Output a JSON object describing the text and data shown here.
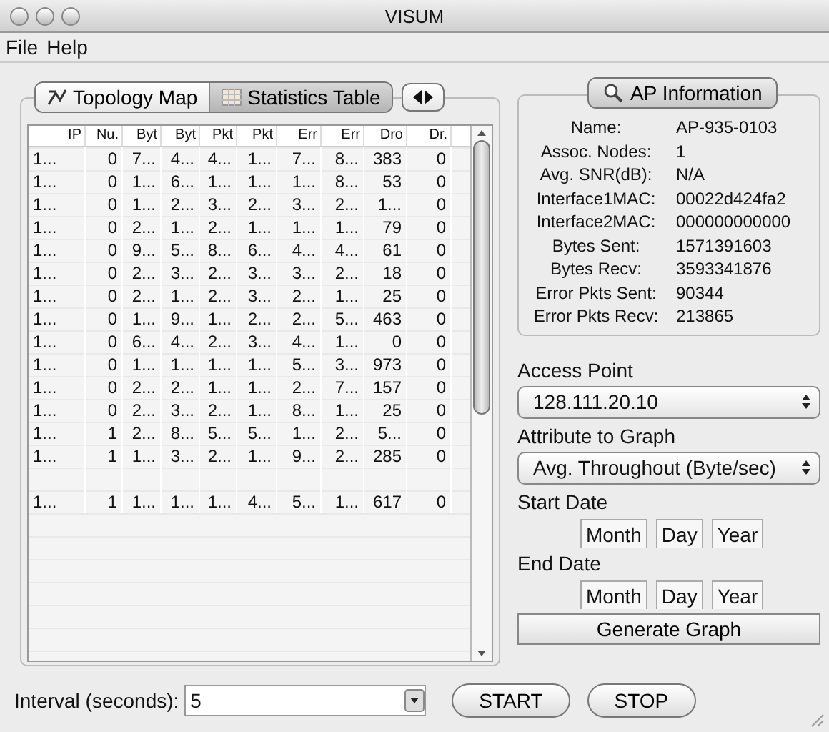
{
  "window": {
    "title": "VISUM"
  },
  "menu": [
    "File",
    "Help"
  ],
  "tabs": [
    {
      "label": "Topology Map",
      "selected": false,
      "kind": "topology"
    },
    {
      "label": "Statistics Table",
      "selected": true,
      "kind": "table"
    }
  ],
  "table": {
    "columns": [
      "IP",
      "Nu.",
      "Byt",
      "Byt",
      "Pkt",
      "Pkt",
      "Err",
      "Err",
      "Dro",
      "Dr."
    ],
    "rows": [
      {
        "kind": "data",
        "cells": [
          "1...",
          "0",
          "7...",
          "4...",
          "4...",
          "1...",
          "7...",
          "8...",
          "383",
          "0"
        ]
      },
      {
        "kind": "data",
        "cells": [
          "1...",
          "0",
          "1...",
          "6...",
          "1...",
          "1...",
          "1...",
          "8...",
          "53",
          "0"
        ]
      },
      {
        "kind": "data",
        "cells": [
          "1...",
          "0",
          "1...",
          "2...",
          "3...",
          "2...",
          "3...",
          "2...",
          "1...",
          "0"
        ]
      },
      {
        "kind": "data",
        "cells": [
          "1...",
          "0",
          "2...",
          "1...",
          "2...",
          "1...",
          "1...",
          "1...",
          "79",
          "0"
        ]
      },
      {
        "kind": "data",
        "cells": [
          "1...",
          "0",
          "9...",
          "5...",
          "8...",
          "6...",
          "4...",
          "4...",
          "61",
          "0"
        ]
      },
      {
        "kind": "data",
        "cells": [
          "1...",
          "0",
          "2...",
          "3...",
          "2...",
          "3...",
          "3...",
          "2...",
          "18",
          "0"
        ]
      },
      {
        "kind": "data",
        "cells": [
          "1...",
          "0",
          "2...",
          "1...",
          "2...",
          "3...",
          "2...",
          "1...",
          "25",
          "0"
        ]
      },
      {
        "kind": "data",
        "cells": [
          "1...",
          "0",
          "1...",
          "9...",
          "1...",
          "2...",
          "2...",
          "5...",
          "463",
          "0"
        ]
      },
      {
        "kind": "data",
        "cells": [
          "1...",
          "0",
          "6...",
          "4...",
          "2...",
          "3...",
          "4...",
          "1...",
          "0",
          "0"
        ]
      },
      {
        "kind": "data",
        "cells": [
          "1...",
          "0",
          "1...",
          "1...",
          "1...",
          "1...",
          "5...",
          "3...",
          "973",
          "0"
        ]
      },
      {
        "kind": "data",
        "cells": [
          "1...",
          "0",
          "2...",
          "2...",
          "1...",
          "1...",
          "2...",
          "7...",
          "157",
          "0"
        ]
      },
      {
        "kind": "data",
        "cells": [
          "1...",
          "0",
          "2...",
          "3...",
          "2...",
          "1...",
          "8...",
          "1...",
          "25",
          "0"
        ]
      },
      {
        "kind": "data",
        "cells": [
          "1...",
          "1",
          "2...",
          "8...",
          "5...",
          "5...",
          "1...",
          "2...",
          "5...",
          "0"
        ]
      },
      {
        "kind": "data",
        "cells": [
          "1...",
          "1",
          "1...",
          "3...",
          "2...",
          "1...",
          "9...",
          "2...",
          "285",
          "0"
        ]
      },
      {
        "kind": "blank"
      },
      {
        "kind": "data",
        "cells": [
          "1...",
          "1",
          "1...",
          "1...",
          "1...",
          "4...",
          "5...",
          "1...",
          "617",
          "0"
        ]
      }
    ]
  },
  "ap_info": {
    "button": "AP Information",
    "fields": [
      {
        "label": "Name:",
        "value": "AP-935-0103"
      },
      {
        "label": "Assoc. Nodes:",
        "value": "1"
      },
      {
        "label": "Avg. SNR(dB):",
        "value": "N/A"
      },
      {
        "label": "Interface1MAC:",
        "value": "00022d424fa2"
      },
      {
        "label": "Interface2MAC:",
        "value": "000000000000"
      },
      {
        "label": "Bytes Sent:",
        "value": "1571391603"
      },
      {
        "label": "Bytes Recv:",
        "value": "3593341876"
      },
      {
        "label": "Error Pkts Sent:",
        "value": "90344"
      },
      {
        "label": "Error Pkts Recv:",
        "value": "213865"
      }
    ]
  },
  "graph": {
    "access_point_label": "Access Point",
    "access_point": "128.111.20.10",
    "attribute_label": "Attribute to Graph",
    "attribute": "Avg. Throughout (Byte/sec)",
    "start_label": "Start Date",
    "start_fields": [
      "Month",
      "Day",
      "Year"
    ],
    "end_label": "End Date",
    "end_fields": [
      "Month",
      "Day",
      "Year"
    ],
    "button": "Generate Graph"
  },
  "bottom": {
    "interval_label": "Interval (seconds):",
    "interval": "5",
    "start": "START",
    "stop": "STOP"
  }
}
